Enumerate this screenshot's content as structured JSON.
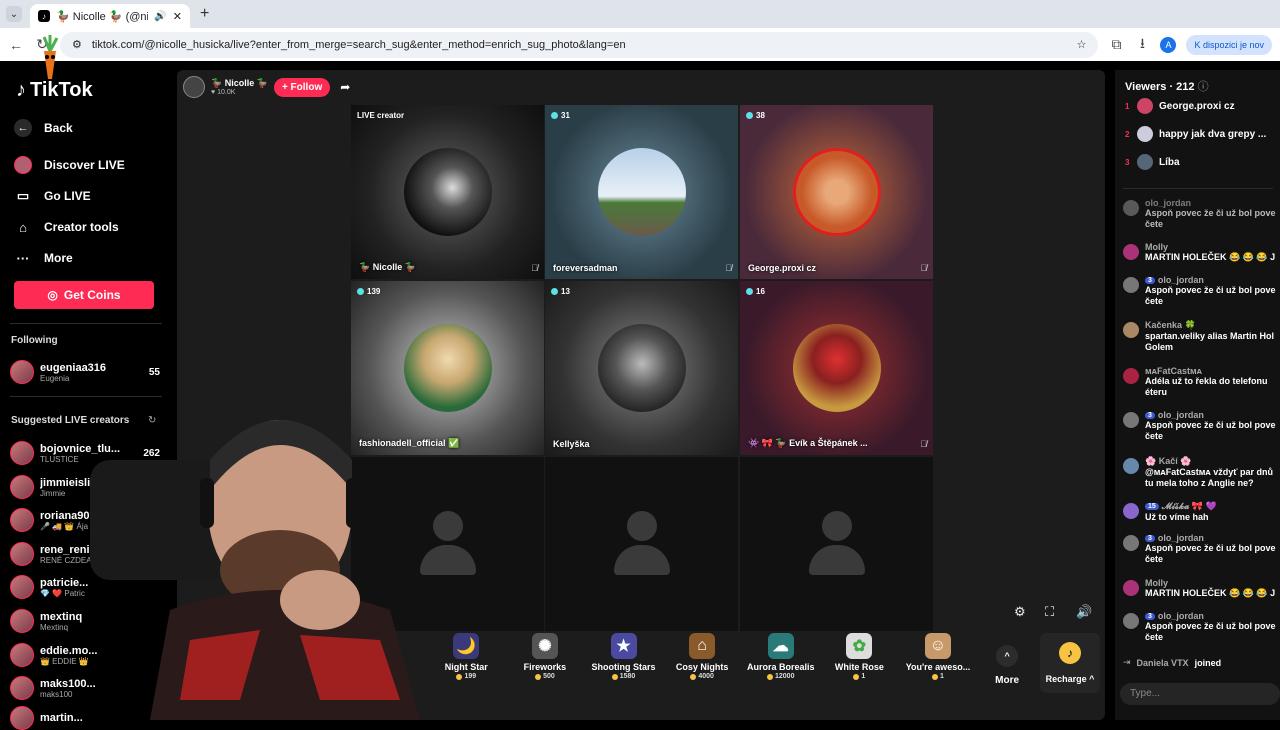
{
  "browser": {
    "tab_title": "🦆 Nicolle 🦆 (@nicolle_hu",
    "url": "tiktok.com/@nicolle_husicka/live?enter_from_merge=search_sug&enter_method=enrich_sug_photo&lang=en",
    "profile_initial": "A",
    "notice": "K dispozici je nov"
  },
  "sidebar": {
    "logo": "TikTok",
    "back": "Back",
    "discover": "Discover LIVE",
    "go_live": "Go LIVE",
    "creator_tools": "Creator tools",
    "more": "More",
    "get_coins": "Get Coins",
    "following_title": "Following",
    "following": [
      {
        "name": "eugeniaa316",
        "sub": "Eugenia",
        "count": "55"
      }
    ],
    "suggested_title": "Suggested LIVE creators",
    "suggested": [
      {
        "name": "bojovnice_tlu...",
        "sub": "TLUSTICE",
        "count": "262"
      },
      {
        "name": "jimmieislive",
        "sub": "Jimmie",
        "count": ""
      },
      {
        "name": "roriana90",
        "sub": "🎤 🚚 👑 Ája Tat",
        "count": ""
      },
      {
        "name": "rene_reni...",
        "sub": "RENÉ CZDEAT",
        "count": ""
      },
      {
        "name": "patricie...",
        "sub": "💎 ❤️ Patric",
        "count": ""
      },
      {
        "name": "mextinq",
        "sub": "Mextinq",
        "count": ""
      },
      {
        "name": "eddie.mo...",
        "sub": "👑 EDDIE 👑",
        "count": ""
      },
      {
        "name": "maks100...",
        "sub": "maks100",
        "count": ""
      },
      {
        "name": "martin...",
        "sub": "",
        "count": ""
      }
    ]
  },
  "host": {
    "name": "🦆 Nicolle 🦆",
    "likes": "10.0K",
    "follow": "+ Follow"
  },
  "grid": {
    "cells": [
      {
        "badge": "LIVE creator",
        "label": "🦆 Nicolle 🦆"
      },
      {
        "badge": "31",
        "label": "foreversadman"
      },
      {
        "badge": "38",
        "label": "George.proxi cz"
      },
      {
        "badge": "139",
        "label": "fashionadell_official ✅"
      },
      {
        "badge": "13",
        "label": "Kellyška"
      },
      {
        "badge": "16",
        "label": "👾 🎀 🦆 Evík a Štěpánek ..."
      }
    ]
  },
  "gifts": [
    {
      "name": "Night Star",
      "price": "199",
      "icon": "🌙"
    },
    {
      "name": "Fireworks",
      "price": "500",
      "icon": "🎆"
    },
    {
      "name": "Shooting Stars",
      "price": "1580",
      "icon": "🌠"
    },
    {
      "name": "Cosy Nights",
      "price": "4000",
      "icon": "🏮"
    },
    {
      "name": "Aurora Borealis",
      "price": "12000",
      "icon": "🌌"
    },
    {
      "name": "White Rose",
      "price": "1",
      "icon": "🌹"
    },
    {
      "name": "You're aweso...",
      "price": "1",
      "icon": "🐱"
    }
  ],
  "more_label": "More",
  "recharge": "Recharge ^",
  "viewers": {
    "title": "Viewers · 212",
    "top": [
      {
        "rank": "1",
        "name": "George.proxi cz"
      },
      {
        "rank": "2",
        "name": "happy jak dva grepy ..."
      },
      {
        "rank": "3",
        "name": "Líba"
      }
    ]
  },
  "chat": [
    {
      "name": "olo_jordan",
      "level": "",
      "text": "Aspoň povec že či už bol pove",
      "text2": "čete"
    },
    {
      "name": "Molly",
      "level": "",
      "text": "MARTIN HOLEČEK 😂 😂 😂 J",
      "text2": ""
    },
    {
      "name": "olo_jordan",
      "level": "3",
      "text": "Aspoň povec že či už bol pove",
      "text2": "čete"
    },
    {
      "name": "Kačenka 🍀",
      "level": "",
      "text": "spartan.veliky alias Martin Hol",
      "text2": "Golem"
    },
    {
      "name": "ᴍᴀFatCastᴍᴀ",
      "level": "",
      "text": "Adéla už to řekla do telefonu",
      "text2": "éteru"
    },
    {
      "name": "olo_jordan",
      "level": "3",
      "text": "Aspoň povec že či už bol pove",
      "text2": "čete"
    },
    {
      "name": "🌸 Kačí 🌸",
      "level": "",
      "text": "@ᴍᴀFatCastᴍᴀ vždyť par dnů",
      "text2": "tu mela toho z Anglie ne?"
    },
    {
      "name": "𝓜𝓲𝓼̌𝓴𝓪 🎀 💜",
      "level": "15",
      "text": "Už to víme hah",
      "text2": ""
    },
    {
      "name": "olo_jordan",
      "level": "3",
      "text": "Aspoň povec že či už bol pove",
      "text2": "čete"
    },
    {
      "name": "Molly",
      "level": "",
      "text": "MARTIN HOLEČEK 😂 😂 😂 J",
      "text2": ""
    },
    {
      "name": "olo_jordan",
      "level": "3",
      "text": "Aspoň povec že či už bol pove",
      "text2": "čete"
    }
  ],
  "joined": {
    "name": "Daniela VTX",
    "text": "joined"
  },
  "type_placeholder": "Type..."
}
